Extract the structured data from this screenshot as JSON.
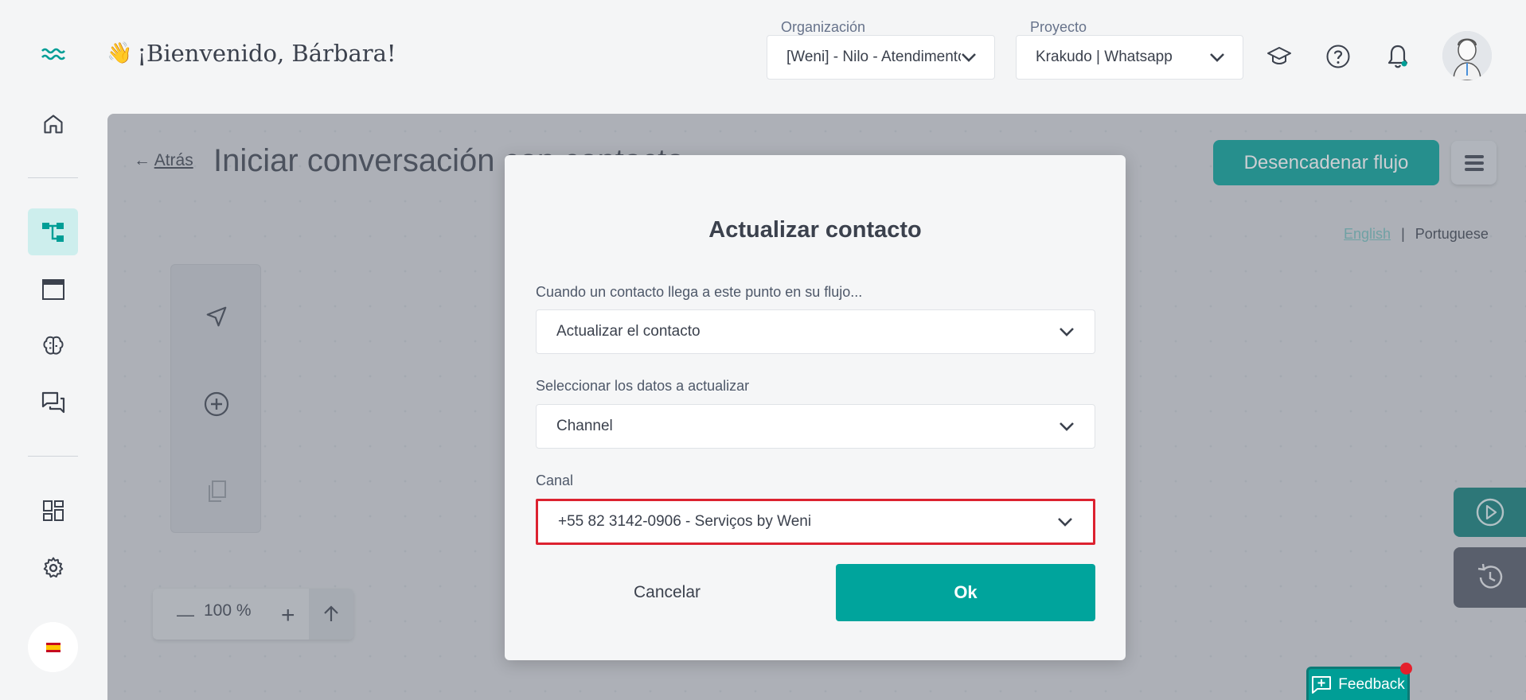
{
  "header": {
    "welcome": "¡Bienvenido, Bárbara!",
    "wave_emoji": "👋",
    "org_label": "Organización",
    "org_value": "[Weni] - Nilo - Atendimento",
    "project_label": "Proyecto",
    "project_value": "Krakudo | Whatsapp"
  },
  "sidebar": {
    "items": [
      {
        "icon": "weni-logo-icon"
      },
      {
        "icon": "home-icon"
      },
      {
        "icon": "flows-icon",
        "active": true
      },
      {
        "icon": "window-icon"
      },
      {
        "icon": "brain-icon"
      },
      {
        "icon": "chat-icon"
      },
      {
        "icon": "dashboard-icon"
      },
      {
        "icon": "gear-icon"
      }
    ],
    "language_flag": "es"
  },
  "editor": {
    "back_arrow": "←",
    "back_label": "Atrás",
    "flow_title": "Iniciar conversación con contacto",
    "trigger_button": "Desencadenar flujo",
    "lang_english": "English",
    "lang_separator": "|",
    "lang_portuguese": "Portuguese",
    "zoom_minus": "—",
    "zoom_level": "100 %",
    "zoom_plus": "+",
    "feedback_label": "Feedback"
  },
  "modal": {
    "title": "Actualizar contacto",
    "field1_label": "Cuando un contacto llega a este punto en su flujo...",
    "field1_value": "Actualizar el contacto",
    "field2_label": "Seleccionar los datos a actualizar",
    "field2_value": "Channel",
    "field3_label": "Canal",
    "field3_value": "+55 82 3142-0906 - Serviços by Weni",
    "cancel_label": "Cancelar",
    "ok_label": "Ok"
  },
  "colors": {
    "accent": "#009e96",
    "highlight": "#dc2230"
  }
}
